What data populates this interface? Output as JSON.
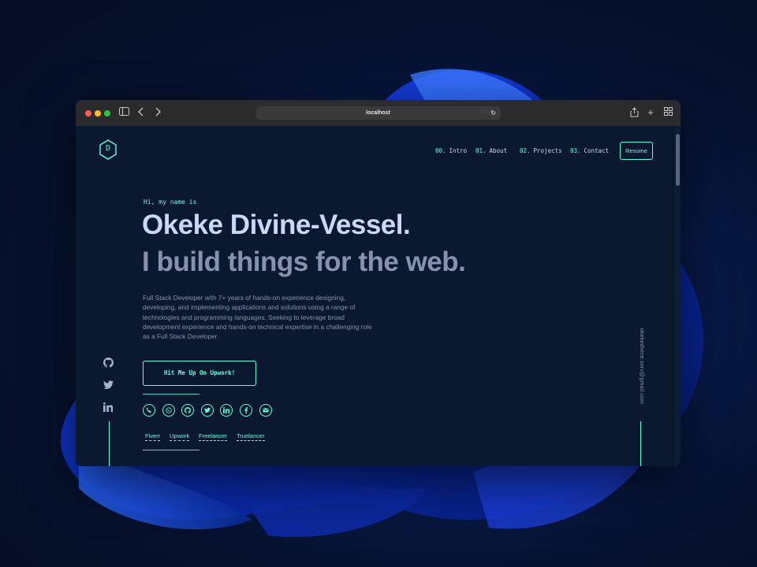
{
  "browser": {
    "url": "localhost",
    "controls": [
      "sidebar-icon",
      "back-icon",
      "forward-icon",
      "reload-icon",
      "share-icon",
      "new-tab-icon",
      "tab-overview-icon"
    ]
  },
  "logo": {
    "letter": "D"
  },
  "nav": {
    "items": [
      {
        "num": "00.",
        "label": "Intro"
      },
      {
        "num": "01.",
        "label": "About"
      },
      {
        "num": "02.",
        "label": "Projects"
      },
      {
        "num": "03.",
        "label": "Contact"
      }
    ],
    "resume_label": "Resume"
  },
  "hero": {
    "greeting": "Hi, my name is",
    "name": "Okeke Divine-Vessel.",
    "tagline": "I build things for the web.",
    "bio": "Full Stack Developer with 7+ years of hands-on experience designing, developing, and implementing applications and solutions using a range of technologies and programming languages. Seeking to leverage broad development experience and hands-on technical expertise in a challenging role as a Full Stack Developer.",
    "cta_label": "Hit Me Up On Upwork!"
  },
  "contact_icons": [
    "phone-icon",
    "whatsapp-icon",
    "github-icon",
    "twitter-icon",
    "linkedin-icon",
    "facebook-icon",
    "email-icon"
  ],
  "platforms": [
    "Fiverr",
    "Upwork",
    "Freelancer",
    "Truelancer"
  ],
  "side_social": [
    "github-icon",
    "twitter-icon",
    "linkedin-icon"
  ],
  "email": "okekedivine.sorv@gmail.com",
  "colors": {
    "accent": "#64ffda",
    "background": "#0a192f",
    "heading": "#ccd6f6",
    "muted": "#8892b0"
  }
}
